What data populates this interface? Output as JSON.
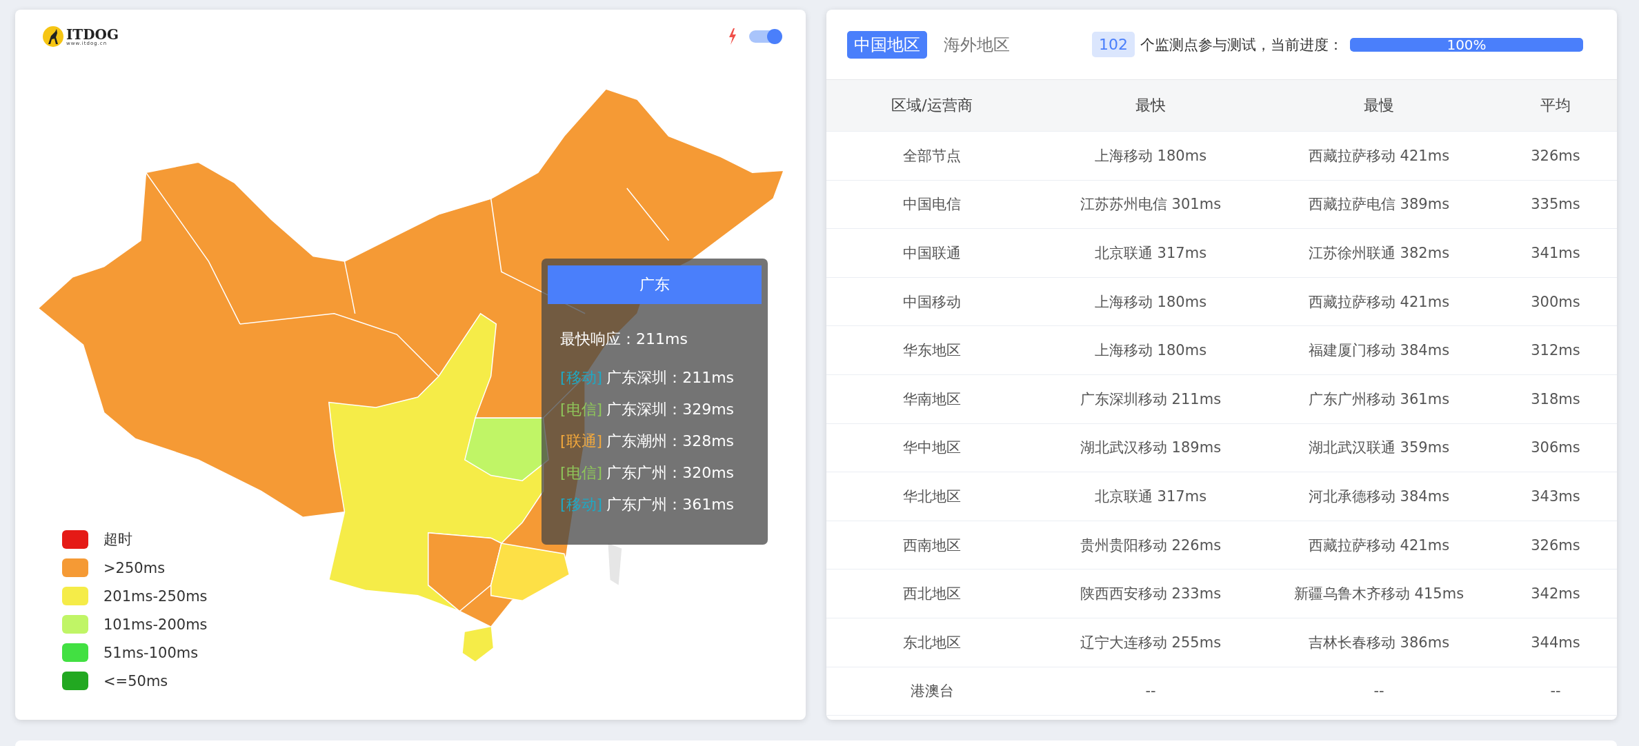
{
  "logo": {
    "name": "ITDOG",
    "url": "www.itdog.cn"
  },
  "toggle": {
    "on": true
  },
  "tooltip": {
    "title": "广东",
    "fastest": "最快响应：211ms",
    "lines": [
      {
        "tag": "[移动]",
        "color": "#1fa9c4",
        "text": "广东深圳：211ms"
      },
      {
        "tag": "[电信]",
        "color": "#8fc65a",
        "text": "广东深圳：329ms"
      },
      {
        "tag": "[联通]",
        "color": "#f2a83c",
        "text": "广东潮州：328ms"
      },
      {
        "tag": "[电信]",
        "color": "#8fc65a",
        "text": "广东广州：320ms"
      },
      {
        "tag": "[移动]",
        "color": "#1fa9c4",
        "text": "广东广州：361ms"
      }
    ]
  },
  "legend": [
    {
      "label": "超时",
      "color": "#e51a16"
    },
    {
      "label": ">250ms",
      "color": "#f59a35"
    },
    {
      "label": "201ms-250ms",
      "color": "#f5ec48"
    },
    {
      "label": "101ms-200ms",
      "color": "#c0f566"
    },
    {
      "label": "51ms-100ms",
      "color": "#42e042"
    },
    {
      "label": "<=50ms",
      "color": "#22a821"
    }
  ],
  "tabs": [
    {
      "label": "中国地区",
      "selected": true
    },
    {
      "label": "海外地区",
      "selected": false
    }
  ],
  "progress": {
    "count": "102",
    "text": "个监测点参与测试，当前进度：",
    "level": 1,
    "reading": "100%"
  },
  "table": {
    "columns": [
      "区域/运营商",
      "最快",
      "最慢",
      "平均"
    ],
    "rows": [
      [
        "全部节点",
        "上海移动 180ms",
        "西藏拉萨移动 421ms",
        "326ms"
      ],
      [
        "中国电信",
        "江苏苏州电信 301ms",
        "西藏拉萨电信 389ms",
        "335ms"
      ],
      [
        "中国联通",
        "北京联通 317ms",
        "江苏徐州联通 382ms",
        "341ms"
      ],
      [
        "中国移动",
        "上海移动 180ms",
        "西藏拉萨移动 421ms",
        "300ms"
      ],
      [
        "华东地区",
        "上海移动 180ms",
        "福建厦门移动 384ms",
        "312ms"
      ],
      [
        "华南地区",
        "广东深圳移动 211ms",
        "广东广州移动 361ms",
        "318ms"
      ],
      [
        "华中地区",
        "湖北武汉移动 189ms",
        "湖北武汉联通 359ms",
        "306ms"
      ],
      [
        "华北地区",
        "北京联通 317ms",
        "河北承德移动 384ms",
        "343ms"
      ],
      [
        "西南地区",
        "贵州贵阳移动 226ms",
        "西藏拉萨移动 421ms",
        "326ms"
      ],
      [
        "西北地区",
        "陕西西安移动 233ms",
        "新疆乌鲁木齐移动 415ms",
        "342ms"
      ],
      [
        "东北地区",
        "辽宁大连移动 255ms",
        "吉林长春移动 386ms",
        "344ms"
      ],
      [
        "港澳台",
        "--",
        "--",
        "--"
      ]
    ]
  }
}
